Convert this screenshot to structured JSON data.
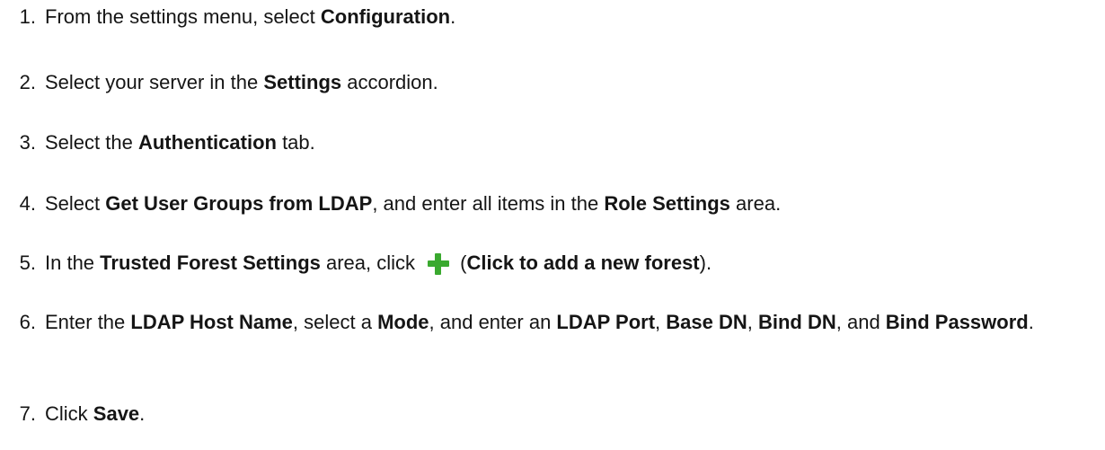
{
  "steps": [
    {
      "number": "1.",
      "parts": [
        "From the settings menu, select ",
        "Configuration",
        "."
      ]
    },
    {
      "number": "2.",
      "parts": [
        "Select your server in the ",
        "Settings",
        " accordion."
      ]
    },
    {
      "number": "3.",
      "parts": [
        "Select the ",
        "Authentication",
        " tab."
      ]
    },
    {
      "number": "4.",
      "parts": [
        "Select ",
        "Get User Groups from LDAP",
        ", and enter all items in the ",
        "Role Settings",
        " area."
      ]
    },
    {
      "number": "5.",
      "parts": [
        "In the ",
        "Trusted Forest Settings",
        " area, click ",
        "(",
        "Click to add a new forest",
        ")."
      ],
      "icon": "plus-icon",
      "icon_color": "#3aa92f"
    },
    {
      "number": "6.",
      "parts": [
        "Enter the ",
        "LDAP Host Name",
        ", select a ",
        "Mode",
        ", and enter an ",
        "LDAP Port",
        ", ",
        "Base DN",
        ", ",
        "Bind DN",
        ", and ",
        "Bind Password",
        "."
      ]
    },
    {
      "number": "7.",
      "parts": [
        "Click ",
        "Save",
        "."
      ]
    }
  ]
}
